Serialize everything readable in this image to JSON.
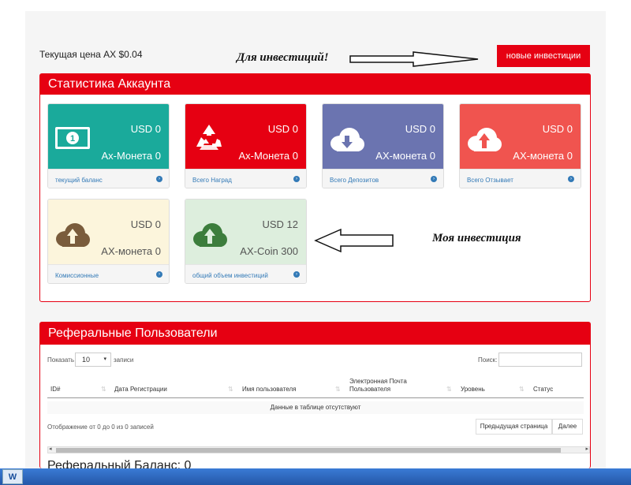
{
  "header": {
    "current_price": "Текущая цена AX $0.04",
    "annotation_invest": "Для инвестиций!",
    "new_investment_button": "новые инвестиции"
  },
  "stats_panel": {
    "title": "Статистика Аккаунта",
    "cards": [
      {
        "usd": "USD 0",
        "coin": "Ax-Монета 0",
        "footer": "текущий баланс",
        "color": "#1aaa9b",
        "icon": "money-icon"
      },
      {
        "usd": "USD 0",
        "coin": "Ax-Монета 0",
        "footer": "Всего Наград",
        "color": "#e60012",
        "icon": "recycle-icon"
      },
      {
        "usd": "USD 0",
        "coin": "AX-монета 0",
        "footer": "Всего Депозитов",
        "color": "#6b74b0",
        "icon": "cloud-download-icon"
      },
      {
        "usd": "USD 0",
        "coin": "AX-монета 0",
        "footer": "Всего Отзывает",
        "color": "#f0544f",
        "icon": "cloud-upload-icon"
      },
      {
        "usd": "USD 0",
        "coin": "AX-монета 0",
        "footer": "Комиссионные",
        "color": "#fcf5dc",
        "icon": "cloud-upload-icon"
      },
      {
        "usd": "USD 12",
        "coin": "AX-Coin 300",
        "footer": "общий объем инвестиций",
        "color": "#ddeedd",
        "icon": "cloud-upload-icon"
      }
    ],
    "annotation_my": "Моя инвестиция"
  },
  "referral_panel": {
    "title": "Реферальные Пользователи",
    "show_label": "Показать",
    "show_value": "10",
    "records_label": "записи",
    "search_label": "Поиск:",
    "columns": [
      "ID#",
      "Дата Регистрации",
      "Имя пользователя",
      "Электронная Почта Пользователя",
      "Уровень",
      "Статус"
    ],
    "empty_text": "Данные в таблице отсутствуют",
    "info_text": "Отображение от 0 до 0 из 0 записей",
    "prev_button": "Предыдущая страница",
    "next_button": "Далее",
    "referral_balance": "Реферальный Баланс: 0"
  },
  "taskbar": {
    "word_icon": "W"
  }
}
